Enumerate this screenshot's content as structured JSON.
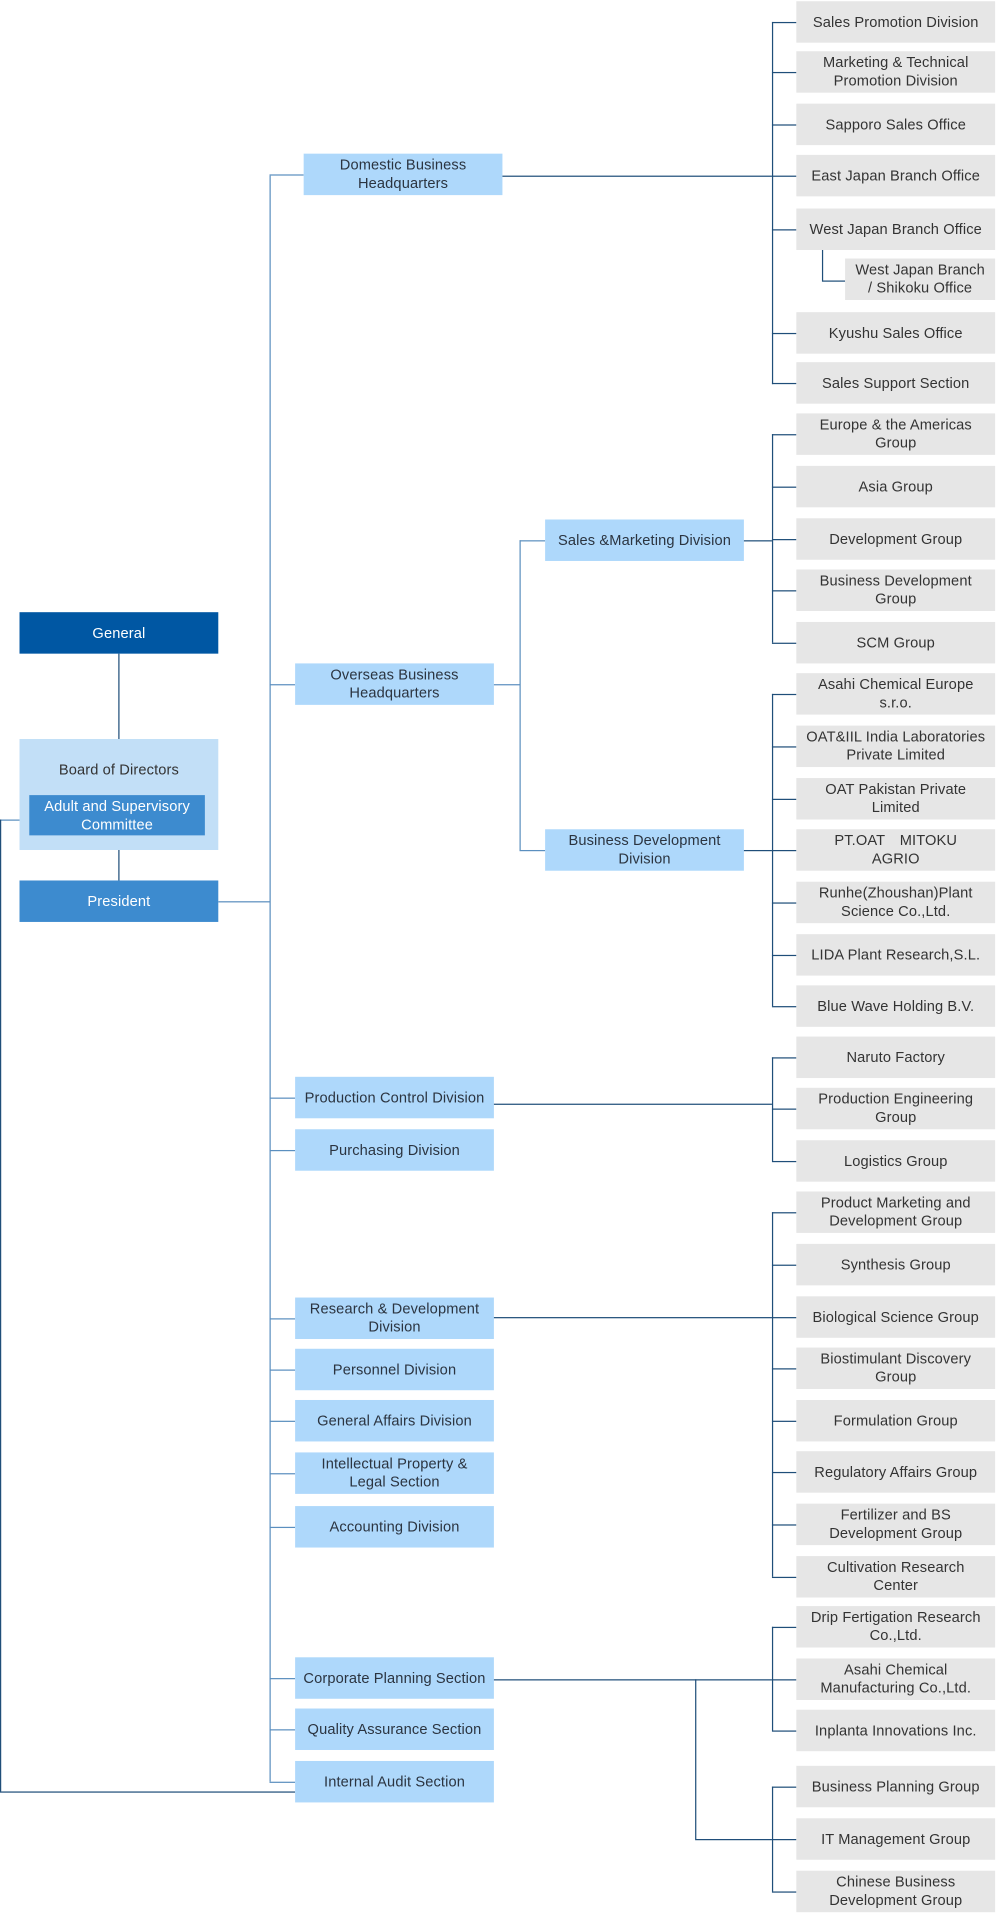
{
  "top": {
    "general": "General",
    "board": "Board of Directors",
    "committee": "Adult and Supervisory Committee",
    "president": "President"
  },
  "domestic": {
    "label": "Domestic Business Headquarters",
    "units": [
      "Sales Promotion Division",
      "Marketing & Technical Promotion Division",
      "Sapporo Sales Office",
      "East Japan Branch Office",
      "West Japan Branch Office",
      "West Japan Branch / Shikoku Office",
      "Kyushu Sales Office",
      "Sales Support Section"
    ]
  },
  "overseas": {
    "label": "Overseas Business Headquarters",
    "sales_marketing": {
      "label": "Sales &Marketing Division",
      "units": [
        "Europe & the Americas Group",
        "Asia Group",
        "Development Group",
        "Business Development Group",
        "SCM Group"
      ]
    },
    "business_development": {
      "label": "Business Development Division",
      "units": [
        "Asahi Chemical Europe s.r.o.",
        "OAT&IIL India Laboratories Private Limited",
        "OAT Pakistan Private Limited",
        "PT.OAT　MITOKU　AGRIO",
        "Runhe(Zhoushan)Plant Science Co.,Ltd.",
        "LIDA Plant Research,S.L.",
        "Blue Wave Holding B.V."
      ]
    }
  },
  "production": {
    "label": "Production Control Division",
    "units": [
      "Naruto Factory",
      "Production Engineering Group",
      "Logistics Group"
    ]
  },
  "purchasing": {
    "label": "Purchasing Division"
  },
  "rnd": {
    "label": "Research & Development Division",
    "units": [
      "Product Marketing and Development Group",
      "Synthesis Group",
      "Biological Science Group",
      "Biostimulant Discovery Group",
      "Formulation Group",
      "Regulatory Affairs Group",
      "Fertilizer and BS Development Group",
      "Cultivation Research Center"
    ]
  },
  "personnel": {
    "label": "Personnel Division"
  },
  "general_affairs": {
    "label": "General Affairs Division"
  },
  "ip_legal": {
    "label": "Intellectual Property & Legal Section"
  },
  "accounting": {
    "label": "Accounting Division"
  },
  "corporate_planning": {
    "label": "Corporate Planning Section",
    "affiliates": [
      "Drip Fertigation Research Co.,Ltd.",
      "Asahi Chemical Manufacturing Co.,Ltd.",
      "Inplanta Innovations Inc."
    ],
    "groups": [
      "Business Planning Group",
      "IT Management Group",
      "Chinese Business Development Group"
    ]
  },
  "quality_assurance": {
    "label": "Quality Assurance Section"
  },
  "internal_audit": {
    "label": "Internal Audit Section"
  },
  "colors": {
    "general": "#0057a3",
    "president": "#3d8bcf",
    "board": "#c2dff7",
    "division": "#aed8fb",
    "unit": "#e6e6e6",
    "line": "#1f4e79"
  }
}
